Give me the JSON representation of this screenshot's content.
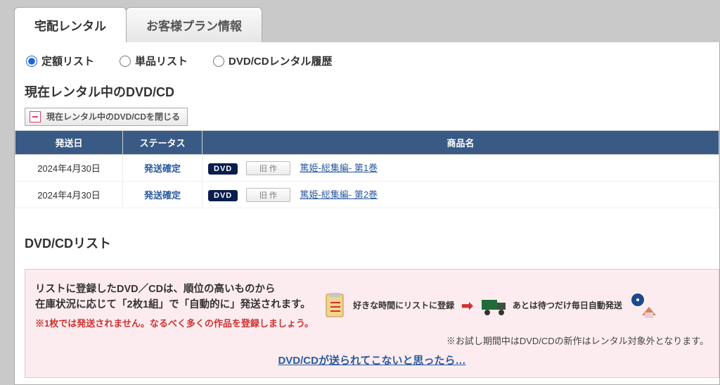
{
  "tabs": {
    "active": "宅配レンタル",
    "inactive": "お客様プラン情報"
  },
  "radio": {
    "opt1": "定額リスト",
    "opt2": "単品リスト",
    "opt3": "DVD/CDレンタル履歴"
  },
  "section": {
    "now_renting": "現在レンタル中のDVD/CD",
    "close_btn": "現在レンタル中のDVD/CDを閉じる",
    "list_title": "DVD/CDリスト"
  },
  "table": {
    "head_date": "発送日",
    "head_status": "ステータス",
    "head_item": "商品名",
    "rows": [
      {
        "date": "2024年4月30日",
        "status": "発送確定",
        "media": "DVD",
        "age": "旧 作",
        "title": "篤姫-総集編- 第1巻"
      },
      {
        "date": "2024年4月30日",
        "status": "発送確定",
        "media": "DVD",
        "age": "旧 作",
        "title": "篤姫-総集編- 第2巻"
      }
    ]
  },
  "promo": {
    "line1a": "リストに登録したDVD／CDは、順位の高いものから",
    "line1b": "在庫状況に応じて「2枚1組」で「自動的に」発送されます。",
    "line2": "※1枚では発送されません。なるべく多くの作品を登録しましょう。",
    "step1": "好きな時間にリストに登録",
    "step2": "あとは待つだけ毎日自動発送",
    "note": "※お試し期間中はDVD/CDの新作はレンタル対象外となります。",
    "help": "DVD/CDが送られてこないと思ったら…"
  }
}
